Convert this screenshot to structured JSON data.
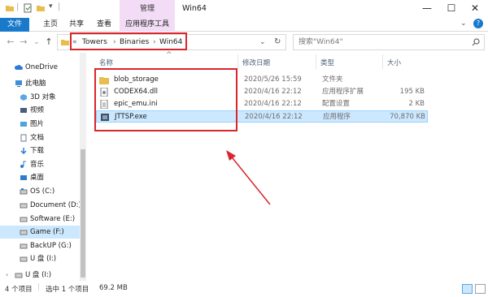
{
  "titlebar": {
    "title": "Win64",
    "context_group": "管理",
    "minimize": "—",
    "maximize": "☐",
    "close": "✕"
  },
  "ribbon": {
    "tabs": [
      "文件",
      "主页",
      "共享",
      "查看",
      "应用程序工具"
    ]
  },
  "nav": {
    "back": "←",
    "forward": "→",
    "recent": "⌄",
    "up": "↑",
    "breadcrumb_prefix": "«",
    "breadcrumb": [
      "Towers",
      "Binaries",
      "Win64"
    ],
    "separator": "›",
    "refresh": "↻",
    "dropdown": "⌄"
  },
  "search": {
    "placeholder": "搜索\"Win64\"",
    "icon": "search-icon"
  },
  "sidebar": {
    "items": [
      {
        "label": "OneDrive",
        "icon": "cloud-icon"
      },
      {
        "label": "此电脑",
        "icon": "computer-icon"
      },
      {
        "label": "3D 对象",
        "icon": "cube-icon"
      },
      {
        "label": "视频",
        "icon": "video-icon"
      },
      {
        "label": "图片",
        "icon": "picture-icon"
      },
      {
        "label": "文档",
        "icon": "document-icon"
      },
      {
        "label": "下载",
        "icon": "download-icon"
      },
      {
        "label": "音乐",
        "icon": "music-icon"
      },
      {
        "label": "桌面",
        "icon": "desktop-icon"
      },
      {
        "label": "OS (C:)",
        "icon": "os-drive-icon"
      },
      {
        "label": "Document (D:)",
        "icon": "drive-icon"
      },
      {
        "label": "Software (E:)",
        "icon": "drive-icon"
      },
      {
        "label": "Game (F:)",
        "icon": "drive-icon"
      },
      {
        "label": "BackUP (G:)",
        "icon": "drive-icon"
      },
      {
        "label": "U 盘 (I:)",
        "icon": "usb-drive-icon"
      },
      {
        "label": "U 盘 (I:)",
        "icon": "usb-drive-icon"
      }
    ]
  },
  "files": {
    "columns": [
      "名称",
      "修改日期",
      "类型",
      "大小"
    ],
    "rows": [
      {
        "name": "blob_storage",
        "date": "2020/5/26 15:59",
        "type": "文件夹",
        "size": "",
        "icon": "folder-icon"
      },
      {
        "name": "CODEX64.dll",
        "date": "2020/4/16 22:12",
        "type": "应用程序扩展",
        "size": "195 KB",
        "icon": "dll-file-icon"
      },
      {
        "name": "epic_emu.ini",
        "date": "2020/4/16 22:12",
        "type": "配置设置",
        "size": "2 KB",
        "icon": "ini-file-icon"
      },
      {
        "name": "JTTSP.exe",
        "date": "2020/4/16 22:12",
        "type": "应用程序",
        "size": "70,870 KB",
        "icon": "exe-file-icon"
      }
    ]
  },
  "status": {
    "count": "4 个项目",
    "selected": "选中 1 个项目",
    "size": "69.2 MB"
  },
  "colors": {
    "accent": "#1979ca",
    "context_tab": "#f3dcf6",
    "selection": "#cce8ff",
    "annotation": "#d9262c"
  }
}
